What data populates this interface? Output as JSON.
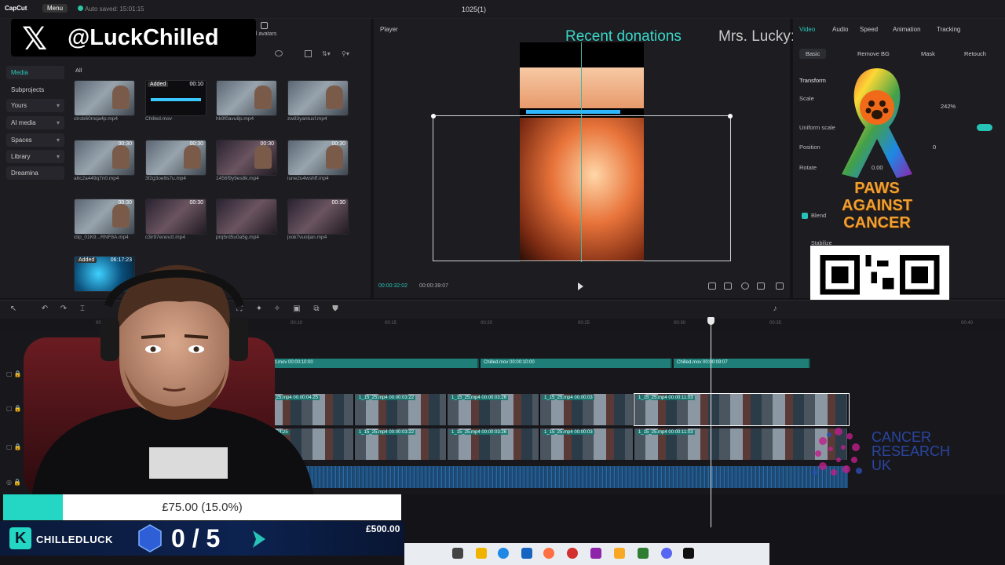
{
  "app": {
    "logo": "CapCut",
    "menu_label": "Menu",
    "autosave": "Auto saved: 15:01:15",
    "title": "1025(1)"
  },
  "social": {
    "handle": "@LuckChilled"
  },
  "media_panel": {
    "top_tab": "al avatars",
    "filter_all": "All",
    "nav": [
      "Media",
      "Subprojects",
      "Yours",
      "AI media",
      "Spaces",
      "Library",
      "Dreamina"
    ],
    "items": [
      {
        "name": "ctrob60mqa4p.mp4",
        "duration": ""
      },
      {
        "name": "Chilled.mov",
        "duration": "00:10",
        "badge": "Added"
      },
      {
        "name": "hk9f0avu8p.mp4",
        "duration": ""
      },
      {
        "name": "zw83yantusf.mp4",
        "duration": ""
      },
      {
        "name": "a6c2a449q7n0.mp4",
        "duration": "00:30"
      },
      {
        "name": "3f2g3oe9s7u.mp4",
        "duration": "00:30"
      },
      {
        "name": "1456f9y9es8k.mp4",
        "duration": "00:30"
      },
      {
        "name": "iune2u4wshff.mp4",
        "duration": "00:30"
      },
      {
        "name": "clip_01K9...RNF8A.mp4",
        "duration": "00:30"
      },
      {
        "name": "c3ir97enovzl.mp4",
        "duration": "00:30"
      },
      {
        "name": "prq5rd5u0a5g.mp4",
        "duration": ""
      },
      {
        "name": "jxok7vuoljan.mp4",
        "duration": "00:30"
      },
      {
        "name": "",
        "duration": "06:17:23",
        "badge": "Added"
      }
    ]
  },
  "player": {
    "header": "Player",
    "current_time": "00:00:32:02",
    "total_time": "00:00:39:07"
  },
  "donations": {
    "label": "Recent donations",
    "name": "Mrs. Lucky:"
  },
  "right_panel": {
    "tabs": [
      "Video",
      "Audio",
      "Speed",
      "Animation",
      "Tracking"
    ],
    "subtabs": [
      "Basic",
      "Remove BG",
      "Mask",
      "Retouch"
    ],
    "section": "Transform",
    "scale_label": "Scale",
    "scale_value": "242%",
    "uniform_label": "Uniform scale",
    "position_label": "Position",
    "position_y": "0",
    "rotate_label": "Rotate",
    "rotate_value": "0.00",
    "blend_label": "Blend",
    "stabilize_label": "Stabilize"
  },
  "timeline": {
    "ruler": [
      "00:00",
      "00:10",
      "00:15",
      "00:20",
      "00:25",
      "00:30",
      "00:35",
      "00:40"
    ],
    "overlay_clips": [
      {
        "label": "Chilled.mov  00:00:10:00"
      },
      {
        "label": "Chilled.mov  00:00:10:00"
      },
      {
        "label": "Chilled.mov  00:00:09:07"
      }
    ],
    "track1_clips": [
      {
        "label": "1_15_25.mp4  00:00:04:25"
      },
      {
        "label": "1_15_25.mp4  00:00:03:22"
      },
      {
        "label": "1_15_25.mp4  00:00:03:26"
      },
      {
        "label": "1_15_25.mp4  00:00:03"
      },
      {
        "label": "1_15_25.mp4  00:00:11:03"
      }
    ],
    "track2_clips": [
      {
        "label": "00:00:04:25"
      },
      {
        "label": "1_15_25.mp4  00:00:03:22"
      },
      {
        "label": "1_15_25.mp4  00:00:03:26"
      },
      {
        "label": "1_15_25.mp4  00:00:03"
      },
      {
        "label": "1_15_25.mp4  00:00:11:03"
      }
    ]
  },
  "goal": {
    "progress_text": "£75.00 (15.0%)",
    "progress_fraction": 0.15,
    "target": "£500.00",
    "brand": "CHILLEDLUCK",
    "counter": "0 / 5"
  },
  "charity": {
    "paws": "PAWS AGAINST CANCER",
    "cru": "CANCER RESEARCH UK"
  },
  "colors": {
    "accent": "#26c3b6",
    "donation_label": "#3bd7c8",
    "goal_fill": "#24d6c4"
  }
}
